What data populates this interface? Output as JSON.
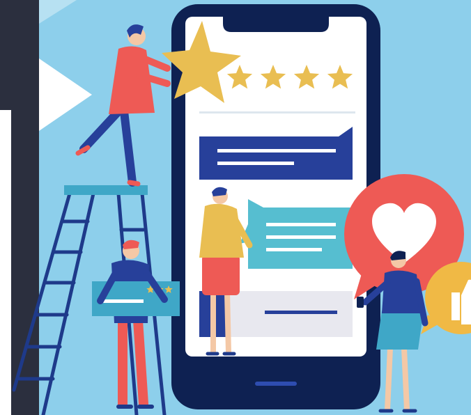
{
  "illustration": {
    "rating": {
      "filled": 4,
      "total": 4
    },
    "card_rating": {
      "filled": 3,
      "total": 3
    }
  },
  "colors": {
    "sky": "#8DCFEB",
    "left_panel": "#2B2F3E",
    "white_card": "#FFFFFF",
    "phone_frame": "#0E2152",
    "phone_screen": "#FFFFFF",
    "star": "#E9BE52",
    "blue_bubble": "#27409A",
    "teal_bubble": "#56BED0",
    "gray_bubble": "#E8E8EF",
    "red": "#EE5A55",
    "heart_bubble": "#EE5A55",
    "thumb_bubble": "#F0B945",
    "ladder": "#1E3A8A",
    "ladder_top": "#3FA7C7"
  }
}
